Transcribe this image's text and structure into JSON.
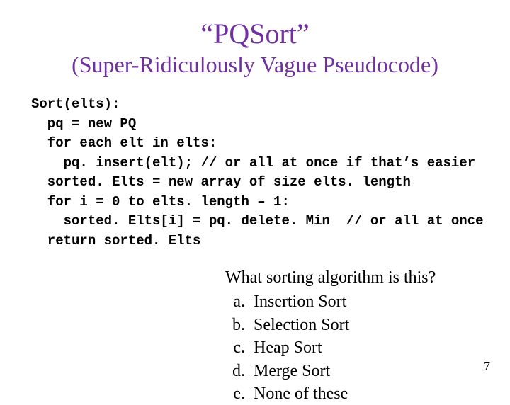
{
  "title": "“PQSort”",
  "subtitle": "(Super-Ridiculously Vague Pseudocode)",
  "code": {
    "l1": "Sort(elts):",
    "l2": "  pq = new PQ",
    "l3": "  for each elt in elts:",
    "l4": "    pq. insert(elt); // or all at once if that’s easier",
    "l5": "  sorted. Elts = new array of size elts. length",
    "l6": "  for i = 0 to elts. length – 1:",
    "l7": "    sorted. Elts[i] = pq. delete. Min  // or all at once",
    "l8": "  return sorted. Elts"
  },
  "question": "What sorting algorithm is this?",
  "options": {
    "a": {
      "letter": "a.",
      "text": "Insertion Sort"
    },
    "b": {
      "letter": "b.",
      "text": "Selection Sort"
    },
    "c": {
      "letter": "c.",
      "text": "Heap Sort"
    },
    "d": {
      "letter": "d.",
      "text": "Merge Sort"
    },
    "e": {
      "letter": "e.",
      "text": "None of these"
    }
  },
  "page_number": "7"
}
